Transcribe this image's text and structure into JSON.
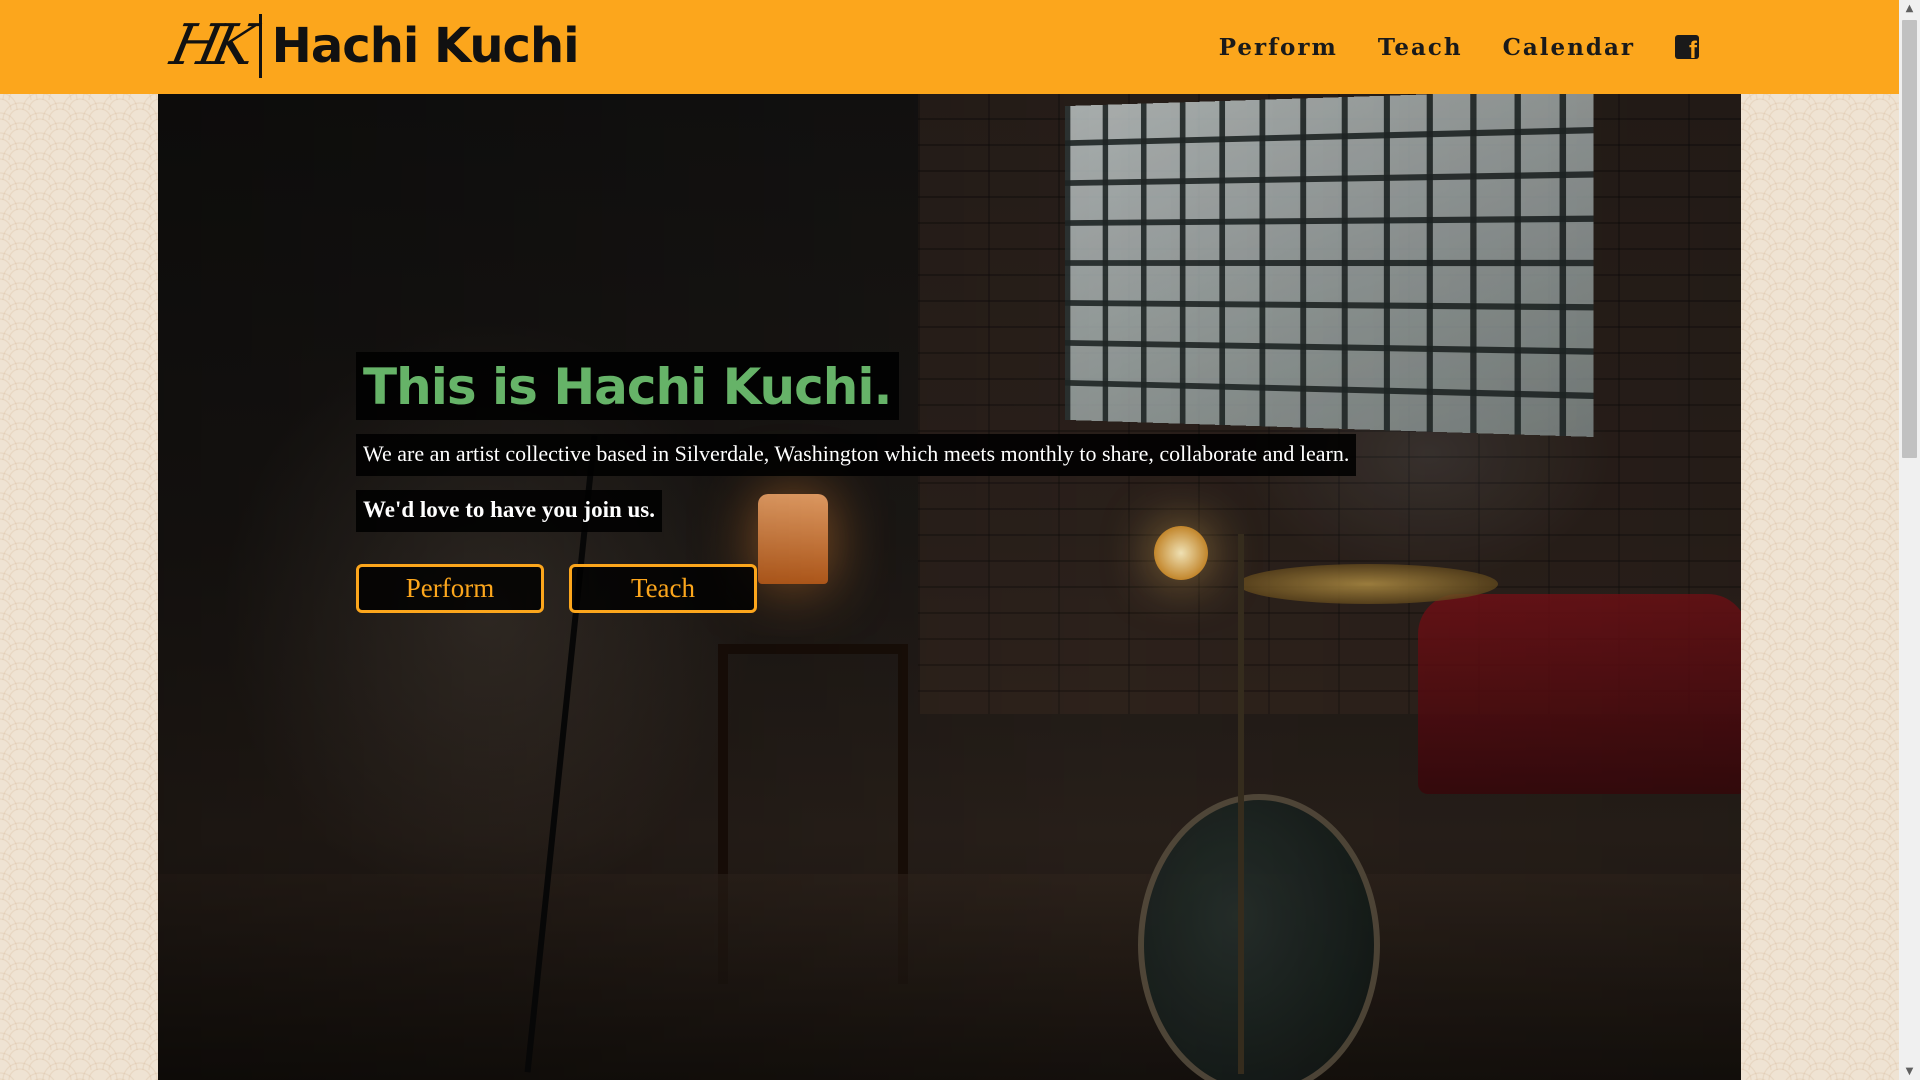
{
  "brand": {
    "mark": "HK",
    "name": "Hachi Kuchi"
  },
  "nav": {
    "items": [
      "Perform",
      "Teach",
      "Calendar"
    ],
    "social_icon": "facebook-square-icon"
  },
  "hero": {
    "title": "This is Hachi Kuchi.",
    "description": "We are an artist collective based in Silverdale, Washington which meets monthly to share, collaborate and learn.",
    "invite": "We'd love to have you join us.",
    "buttons": [
      "Perform",
      "Teach"
    ]
  },
  "colors": {
    "accent": "#fca61c",
    "title_green": "#66b368",
    "text_dark": "#1a1a1a"
  },
  "scrollbar": {
    "up_icon": "▲",
    "down_icon": "▼"
  }
}
